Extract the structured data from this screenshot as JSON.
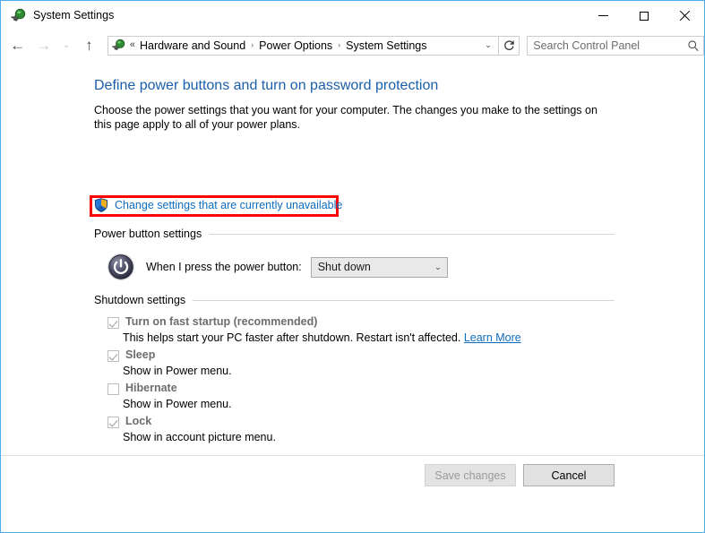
{
  "window": {
    "title": "System Settings",
    "title_icon": "power-plug-icon",
    "controls": {
      "minimize": "minimize-icon",
      "maximize": "maximize-icon",
      "close": "close-icon"
    }
  },
  "navbar": {
    "back_icon": "←",
    "forward_icon": "→",
    "recent_icon": "⌄",
    "up_icon": "↑",
    "address_icon": "power-plug-icon",
    "overflow": "«",
    "breadcrumbs": [
      "Hardware and Sound",
      "Power Options",
      "System Settings"
    ],
    "chevron": "›",
    "dropdown_chevron": "⌄",
    "refresh_icon": "refresh-icon",
    "search": {
      "placeholder": "Search Control Panel",
      "icon": "search-icon"
    }
  },
  "page": {
    "heading": "Define power buttons and turn on password protection",
    "description": "Choose the power settings that you want for your computer. The changes you make to the settings on this page apply to all of your power plans.",
    "uac": {
      "icon": "uac-shield-icon",
      "link": "Change settings that are currently unavailable",
      "highlight_color": "#fe0000"
    }
  },
  "power_button_settings": {
    "group_label": "Power button settings",
    "icon": "power-button-icon",
    "label": "When I press the power button:",
    "selected": "Shut down",
    "chevron": "⌄",
    "disabled": true
  },
  "shutdown_settings": {
    "group_label": "Shutdown settings",
    "items": [
      {
        "label": "Turn on fast startup (recommended)",
        "checked": true,
        "sub": "This helps start your PC faster after shutdown. Restart isn't affected.",
        "link": "Learn More"
      },
      {
        "label": "Sleep",
        "checked": true,
        "sub": "Show in Power menu.",
        "link": ""
      },
      {
        "label": "Hibernate",
        "checked": false,
        "sub": "Show in Power menu.",
        "link": ""
      },
      {
        "label": "Lock",
        "checked": true,
        "sub": "Show in account picture menu.",
        "link": ""
      }
    ]
  },
  "footer": {
    "save_label": "Save changes",
    "save_disabled": true,
    "cancel_label": "Cancel"
  }
}
